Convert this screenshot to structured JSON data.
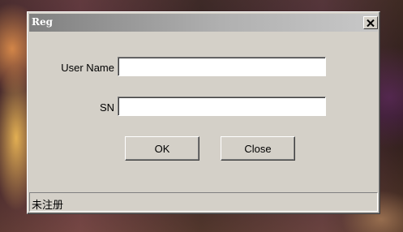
{
  "window": {
    "title": "Reg",
    "close_icon": "close-icon"
  },
  "form": {
    "username_label": "User Name",
    "username_value": "",
    "sn_label": "SN",
    "sn_value": ""
  },
  "buttons": {
    "ok_label": "OK",
    "close_label": "Close"
  },
  "status": {
    "text": "未注册"
  },
  "colors": {
    "dialog_bg": "#d4d0c8",
    "titlebar_start": "#808080",
    "titlebar_end": "#c8c8c8"
  }
}
